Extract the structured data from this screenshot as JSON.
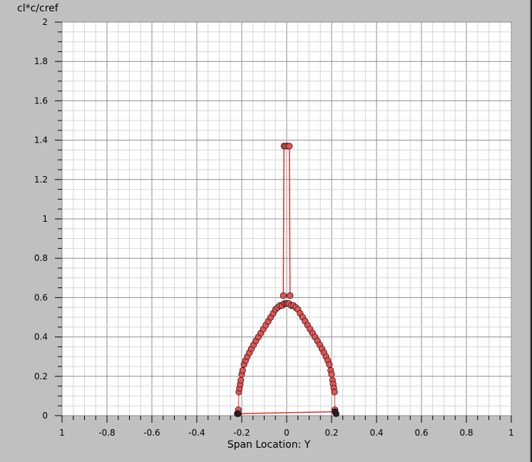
{
  "chart_data": {
    "type": "line",
    "title": "",
    "xlabel": "Span Location: Y",
    "ylabel": "cl*c/cref",
    "xlim": [
      -1,
      1
    ],
    "ylim": [
      0,
      2
    ],
    "x_tick_labels": [
      "1",
      "-0.8",
      "-0.6",
      "-0.4",
      "-0.2",
      "0",
      "0.2",
      "0.4",
      "0.6",
      "0.8",
      "1"
    ],
    "y_tick_labels": [
      "0",
      "0.2",
      "0.4",
      "0.6",
      "0.8",
      "1",
      "1.2",
      "1.4",
      "1.6",
      "1.8",
      "2"
    ],
    "grid": true,
    "series": [
      {
        "color": "#f07070",
        "marker_color": "#e05555",
        "x": [
          -0.215,
          -0.213,
          -0.21,
          -0.207,
          -0.204,
          -0.2,
          -0.196,
          -0.19,
          -0.183,
          -0.175,
          -0.166,
          -0.157,
          -0.147,
          -0.137,
          -0.126,
          -0.115,
          -0.104,
          -0.093,
          -0.082,
          -0.071,
          -0.06,
          -0.05,
          -0.04,
          -0.03,
          -0.02,
          -0.01,
          -0.003
        ],
        "y": [
          0.03,
          0.12,
          0.14,
          0.16,
          0.18,
          0.21,
          0.23,
          0.26,
          0.28,
          0.3,
          0.32,
          0.34,
          0.36,
          0.38,
          0.4,
          0.42,
          0.44,
          0.46,
          0.48,
          0.5,
          0.52,
          0.54,
          0.55,
          0.56,
          0.56,
          0.57,
          0.57
        ]
      },
      {
        "color": "#f07070",
        "marker_color": "#e05555",
        "x": [
          0.003,
          0.01,
          0.02,
          0.03,
          0.04,
          0.05,
          0.06,
          0.071,
          0.082,
          0.093,
          0.104,
          0.115,
          0.126,
          0.137,
          0.147,
          0.157,
          0.166,
          0.175,
          0.183,
          0.19,
          0.196,
          0.2,
          0.204,
          0.207,
          0.21,
          0.213,
          0.215
        ],
        "y": [
          0.57,
          0.57,
          0.56,
          0.56,
          0.55,
          0.54,
          0.52,
          0.5,
          0.48,
          0.46,
          0.44,
          0.42,
          0.4,
          0.38,
          0.36,
          0.34,
          0.32,
          0.3,
          0.28,
          0.26,
          0.23,
          0.21,
          0.18,
          0.16,
          0.14,
          0.12,
          0.03
        ]
      },
      {
        "color": "#e03030",
        "marker_color": "#e05555",
        "x": [
          -0.015,
          -0.012,
          -0.005,
          0.005,
          0.012,
          0.015
        ],
        "y": [
          0.61,
          1.37,
          1.37,
          1.37,
          1.37,
          0.61
        ]
      },
      {
        "color": "#e03030",
        "marker_color": "#202020",
        "x": [
          -0.22,
          -0.215,
          0.215,
          0.22
        ],
        "y": [
          0.01,
          0.01,
          0.02,
          0.01
        ]
      }
    ]
  }
}
